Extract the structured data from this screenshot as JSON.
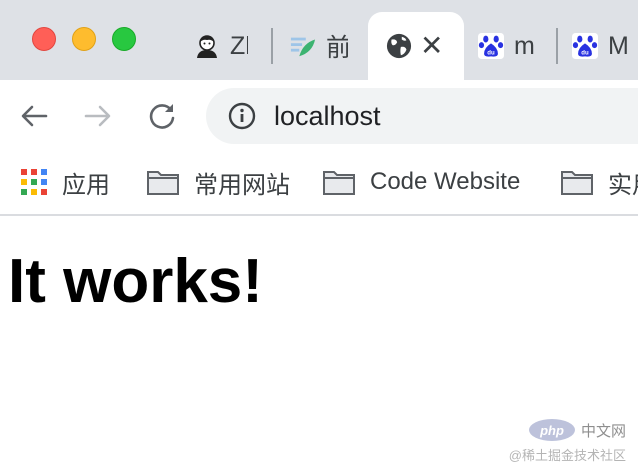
{
  "tabs": [
    {
      "title": "Zh",
      "icon": "avatar-icon"
    },
    {
      "title": "前端",
      "icon": "feather-icon"
    },
    {
      "title": "",
      "icon": "globe-icon",
      "active": true
    },
    {
      "title": "m",
      "icon": "baidu-paw-icon"
    },
    {
      "title": "M",
      "icon": "baidu-paw-icon"
    }
  ],
  "address_bar": {
    "url": "localhost"
  },
  "bookmarks": [
    {
      "label": "应用",
      "icon": "apps-grid-icon"
    },
    {
      "label": "常用网站",
      "icon": "folder-icon"
    },
    {
      "label": "Code Website",
      "icon": "folder-icon"
    },
    {
      "label": "实用",
      "icon": "folder-icon"
    }
  ],
  "page": {
    "headline": "It works!"
  },
  "watermark": {
    "logo_text": "php",
    "cn_text": "中文网",
    "subtext": "@稀土掘金技术社区"
  },
  "colors": {
    "tabstrip_bg": "#dee1e6",
    "close": "#ff5f57",
    "minimize": "#febc2e",
    "maximize": "#28c840",
    "baidu_blue": "#2932e1"
  }
}
